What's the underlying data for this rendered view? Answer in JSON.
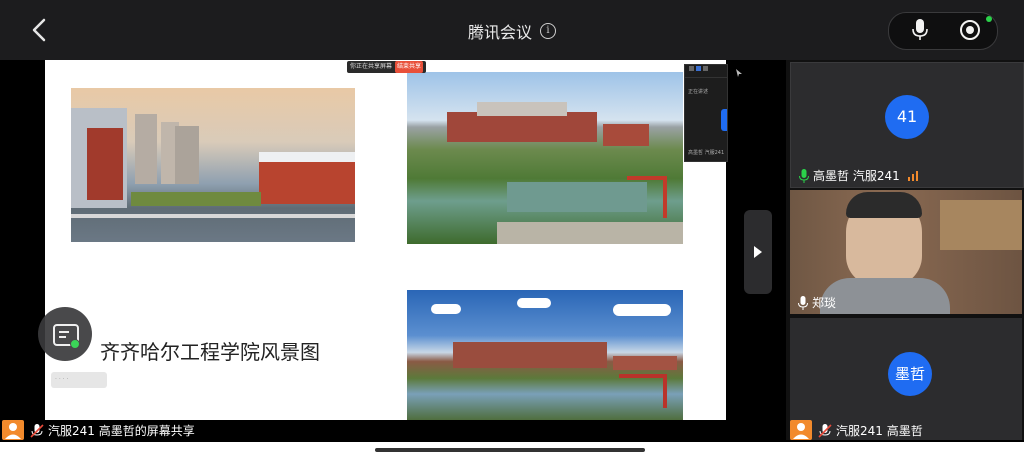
{
  "header": {
    "title": "腾讯会议",
    "info_symbol": "i"
  },
  "slide": {
    "title": "齐齐哈尔工程学院风景图",
    "share_notice": "你正在共享屏幕",
    "share_stop": "结束共享",
    "mini_text": "正在讲述",
    "mini_caption": "高墨哲 汽服241"
  },
  "participants": [
    {
      "avatar": "41",
      "label": "高墨哲 汽服241"
    },
    {
      "label": "郑琰"
    },
    {
      "avatar": "墨哲",
      "label": "汽服241 高墨哲"
    }
  ],
  "share_bar": {
    "label": "汽服241 高墨哲的屏幕共享"
  },
  "colors": {
    "accent_blue": "#1f6cf2",
    "mic_green": "#2bd24a",
    "user_orange": "#f28a2c"
  }
}
